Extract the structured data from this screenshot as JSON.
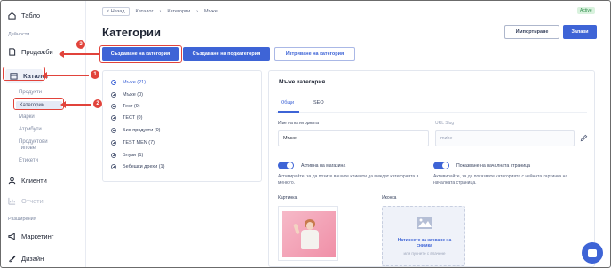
{
  "sidebar": {
    "dashboard": "Табло",
    "section_activities": "Дейности",
    "sales": "Продажби",
    "catalog": "Каталог",
    "catalog_items": [
      "Продукти",
      "Категории",
      "Марки",
      "Атрибути",
      "Продуктови типове",
      "Етикети"
    ],
    "clients": "Клиенти",
    "reports": "Отчети",
    "section_extensions": "Разширения",
    "marketing": "Маркетинг",
    "design": "Дизайн"
  },
  "breadcrumb": {
    "back": "< Назад",
    "items": [
      "Каталог",
      "Категории",
      "Мъже"
    ]
  },
  "status_badge": "Active",
  "page_title": "Категории",
  "toolbar": {
    "import_label": "Импортиране",
    "save_label": "Запази",
    "create_category": "Създаване на категория",
    "create_subcategory": "Създаване на подкатегория",
    "delete_category": "Изтриване на категория"
  },
  "tree": {
    "items": [
      "Мъже (21)",
      "Мъже (0)",
      "Тест (9)",
      "ТЕСТ (0)",
      "Био продукти (0)",
      "TEST MEN (7)",
      "Блузи (1)",
      "Бебешки дрехи (1)"
    ]
  },
  "detail": {
    "title": "Мъже категория",
    "tab_general": "Общи",
    "tab_seo": "SEO",
    "name_label": "Име на категорията",
    "name_value": "Мъже",
    "slug_label": "URL Slug",
    "slug_value": "mzhe",
    "store_toggle_label": "Активна на магазина",
    "store_toggle_desc": "Активирайте, за да позите вашите клиенти да виждат категорията в менюто.",
    "home_toggle_label": "Показване на началната страница",
    "home_toggle_desc": "Активирайте, за да показвате категорията с нейната картинка на началната страница.",
    "image_label": "Картинка",
    "icon_label": "Иконка",
    "upload_link": "Натиснете за качване на снимка",
    "upload_sub": "или пуснете с влачене"
  },
  "annotations": {
    "step1": "1",
    "step2": "2",
    "step3": "3"
  },
  "colors": {
    "accent": "#3e64d6",
    "annotation": "#e1433b"
  }
}
